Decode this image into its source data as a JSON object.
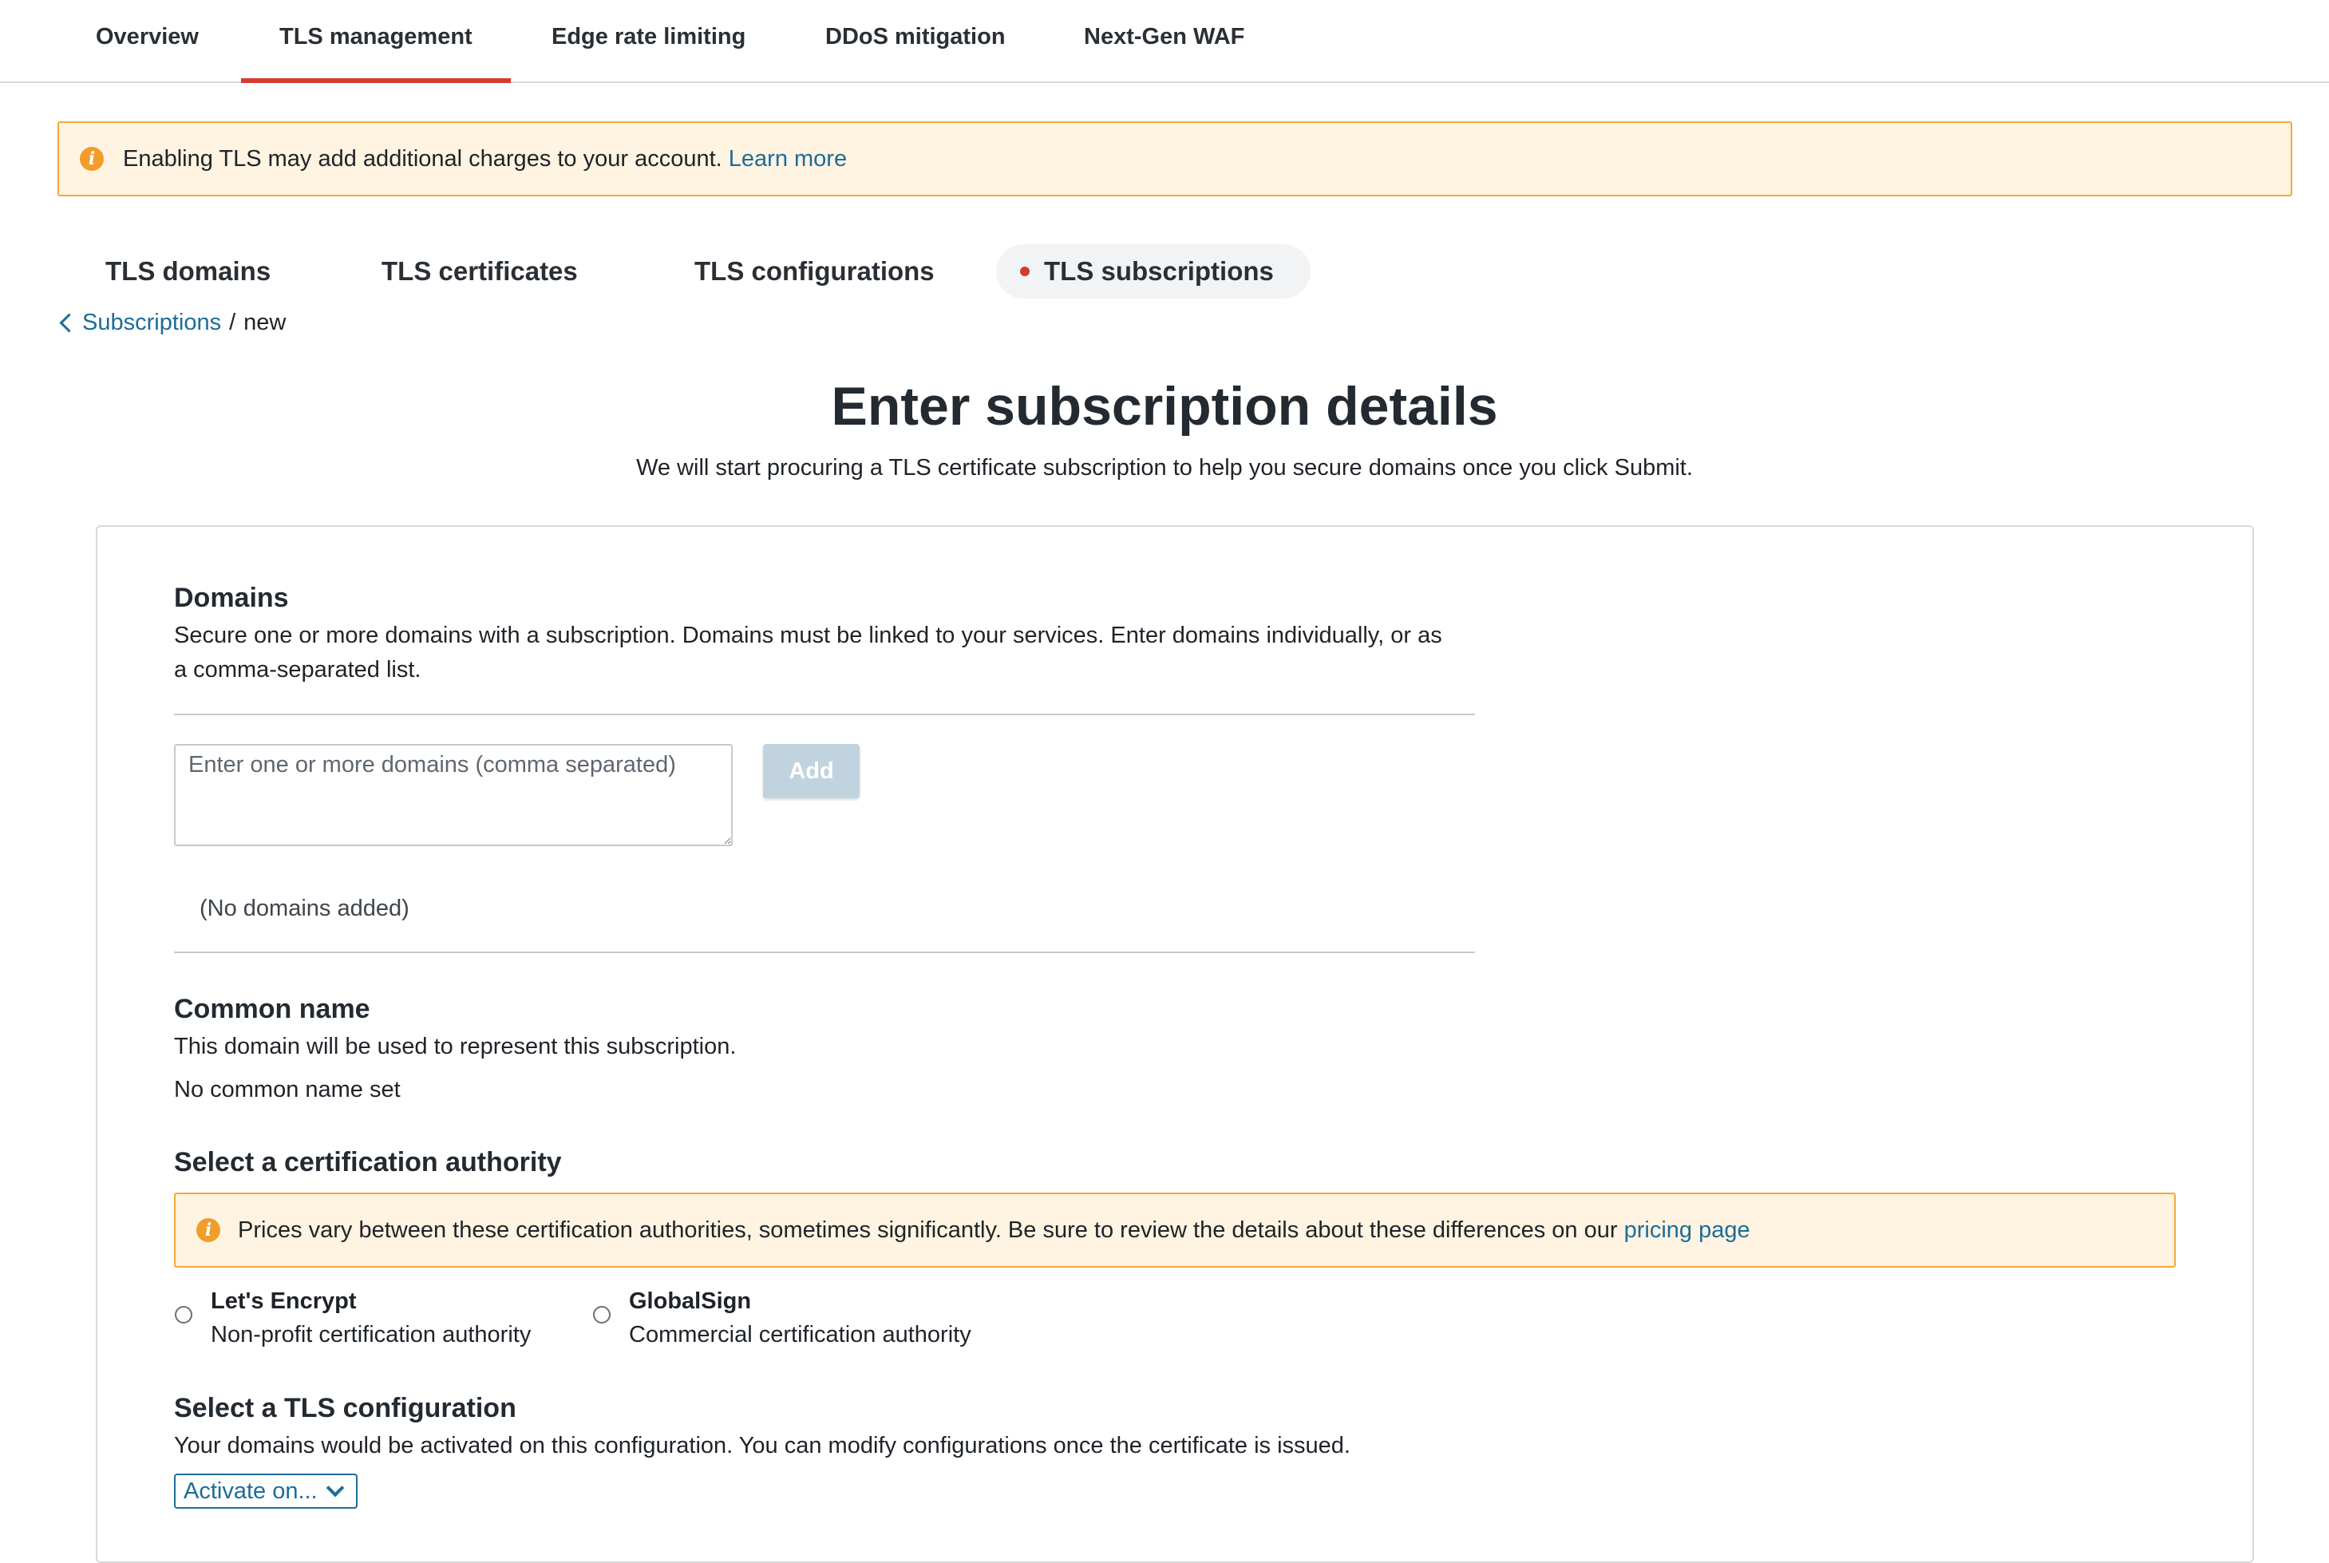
{
  "top_tabs": [
    {
      "label": "Overview"
    },
    {
      "label": "TLS management"
    },
    {
      "label": "Edge rate limiting"
    },
    {
      "label": "DDoS mitigation"
    },
    {
      "label": "Next-Gen WAF"
    }
  ],
  "notice": {
    "text": "Enabling TLS may add additional charges to your account.",
    "link": "Learn more"
  },
  "sub_tabs": [
    {
      "label": "TLS domains"
    },
    {
      "label": "TLS certificates"
    },
    {
      "label": "TLS configurations"
    },
    {
      "label": "TLS subscriptions"
    }
  ],
  "breadcrumb": {
    "parent": "Subscriptions",
    "separator": "/",
    "current": "new"
  },
  "page": {
    "title": "Enter subscription details",
    "subtitle": "We will start procuring a TLS certificate subscription to help you secure domains once you click Submit."
  },
  "domains": {
    "title": "Domains",
    "description_line1": "Secure one or more domains with a subscription. Domains must be linked to your services. Enter domains individually, or as",
    "description_line2": "a comma-separated list.",
    "input_placeholder": "Enter one or more domains (comma separated)",
    "input_value": "",
    "add_label": "Add",
    "empty_text": "(No domains added)"
  },
  "common_name": {
    "title": "Common name",
    "description": "This domain will be used to represent this subscription.",
    "value": "No common name set"
  },
  "certification_authority": {
    "title": "Select a certification authority",
    "notice_text": "Prices vary between these certification authorities, sometimes significantly. Be sure to review the details about these differences on our",
    "notice_link": "pricing page",
    "options": [
      {
        "label": "Let's Encrypt",
        "description": "Non-profit certification authority"
      },
      {
        "label": "GlobalSign",
        "description": "Commercial certification authority"
      }
    ]
  },
  "tls_configuration": {
    "title": "Select a TLS configuration",
    "description": "Your domains would be activated on this configuration. You can modify configurations once the certificate is issued.",
    "select_value": "Activate on..."
  },
  "colors": {
    "accent_red": "#d43b30",
    "link_blue": "#1d6c99",
    "warning_bg": "#fff3e1",
    "warning_border": "#f3a83b"
  }
}
